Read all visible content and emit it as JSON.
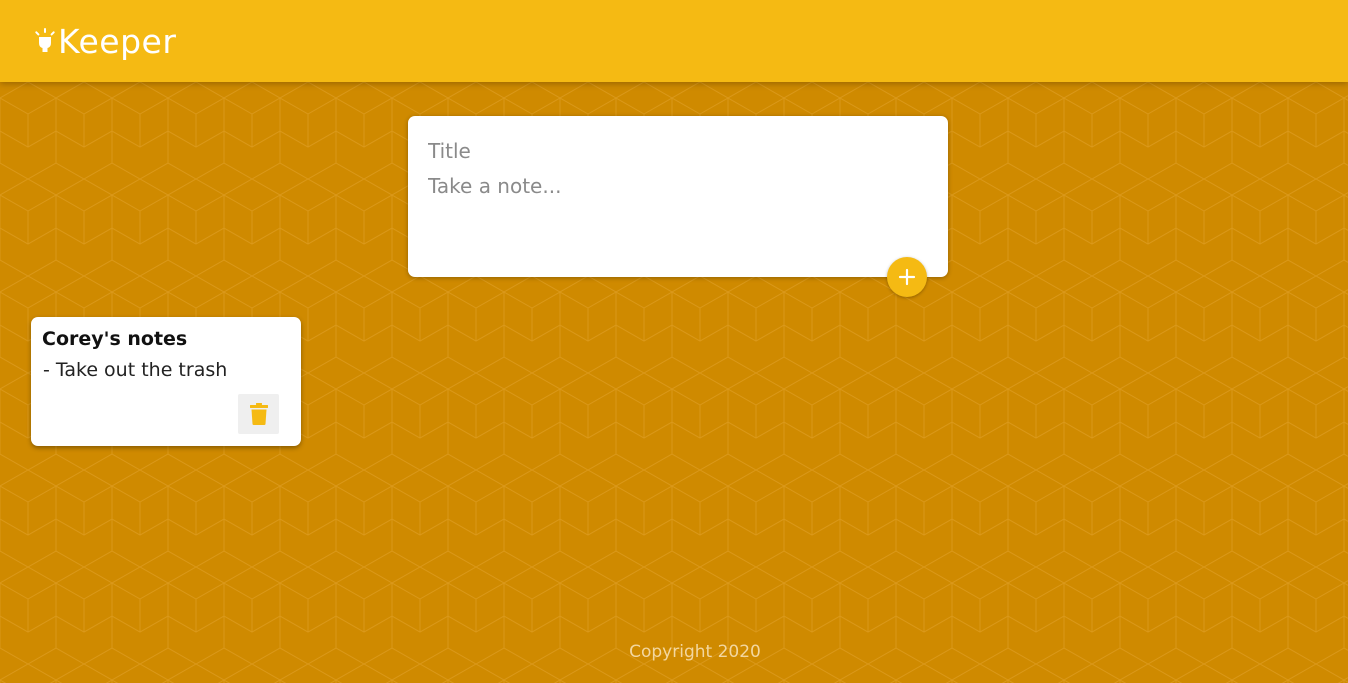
{
  "header": {
    "app_name": "Keeper",
    "logo_icon": "lightbulb-icon",
    "color": "#f5ba13"
  },
  "create_note": {
    "title_placeholder": "Title",
    "content_placeholder": "Take a note...",
    "title_value": "",
    "content_value": "",
    "add_icon": "plus-icon"
  },
  "notes": [
    {
      "title": "Corey's notes",
      "content": "- Take out the trash",
      "delete_icon": "trash-icon"
    }
  ],
  "footer": {
    "text": "Copyright 2020"
  },
  "colors": {
    "accent": "#f5ba13",
    "background": "#cf8a00",
    "card": "#ffffff"
  }
}
